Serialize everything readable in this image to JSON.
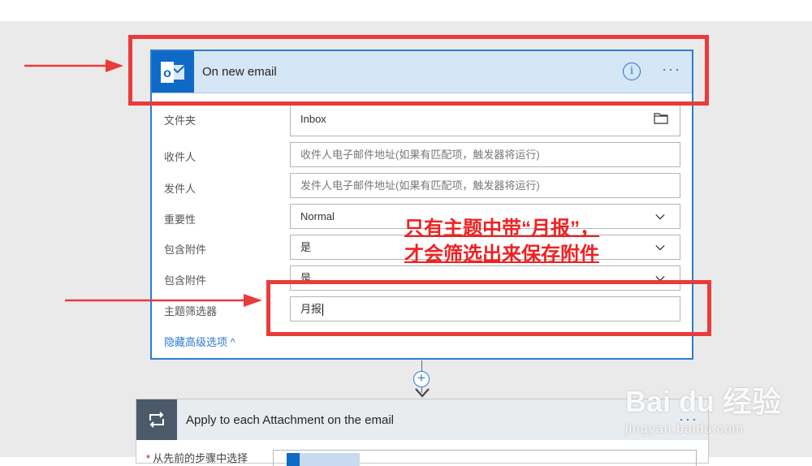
{
  "trigger": {
    "title": "On new email",
    "fields": [
      {
        "label": "文件夹",
        "value": "Inbox",
        "placeholder": ""
      },
      {
        "label": "收件人",
        "value": "",
        "placeholder": "收件人电子邮件地址(如果有匹配项，触发器将运行)"
      },
      {
        "label": "发件人",
        "value": "",
        "placeholder": "发件人电子邮件地址(如果有匹配项，触发器将运行)"
      },
      {
        "label": "重要性",
        "value": "Normal",
        "placeholder": ""
      },
      {
        "label": "包含附件",
        "value": "是",
        "placeholder": ""
      },
      {
        "label": "包含附件",
        "value": "是",
        "placeholder": ""
      },
      {
        "label": "主题筛选器",
        "value": "月报",
        "placeholder": ""
      }
    ],
    "advanced_link": "隐藏高级选项 ^"
  },
  "apply_each": {
    "title": "Apply to each Attachment on the email",
    "row_label": "从先前的步骤中选择",
    "required_mark": "*"
  },
  "annotation": {
    "line1": "只有主题中带“月报”，",
    "line2": "才会筛选出来保存附件"
  },
  "watermark": {
    "logo_text": "Bai du 经验",
    "url": "jingyan.baidu.com"
  },
  "colors": {
    "accent": "#2b7cd3",
    "outlook_blue": "#0f69c7",
    "annotation_red": "#e93b3b",
    "header_bg": "#d5e6f6"
  },
  "icons": [
    "outlook-icon",
    "info-icon",
    "more-icon",
    "folder-icon",
    "chevron-down-icon",
    "add-step-icon",
    "loop-icon"
  ]
}
